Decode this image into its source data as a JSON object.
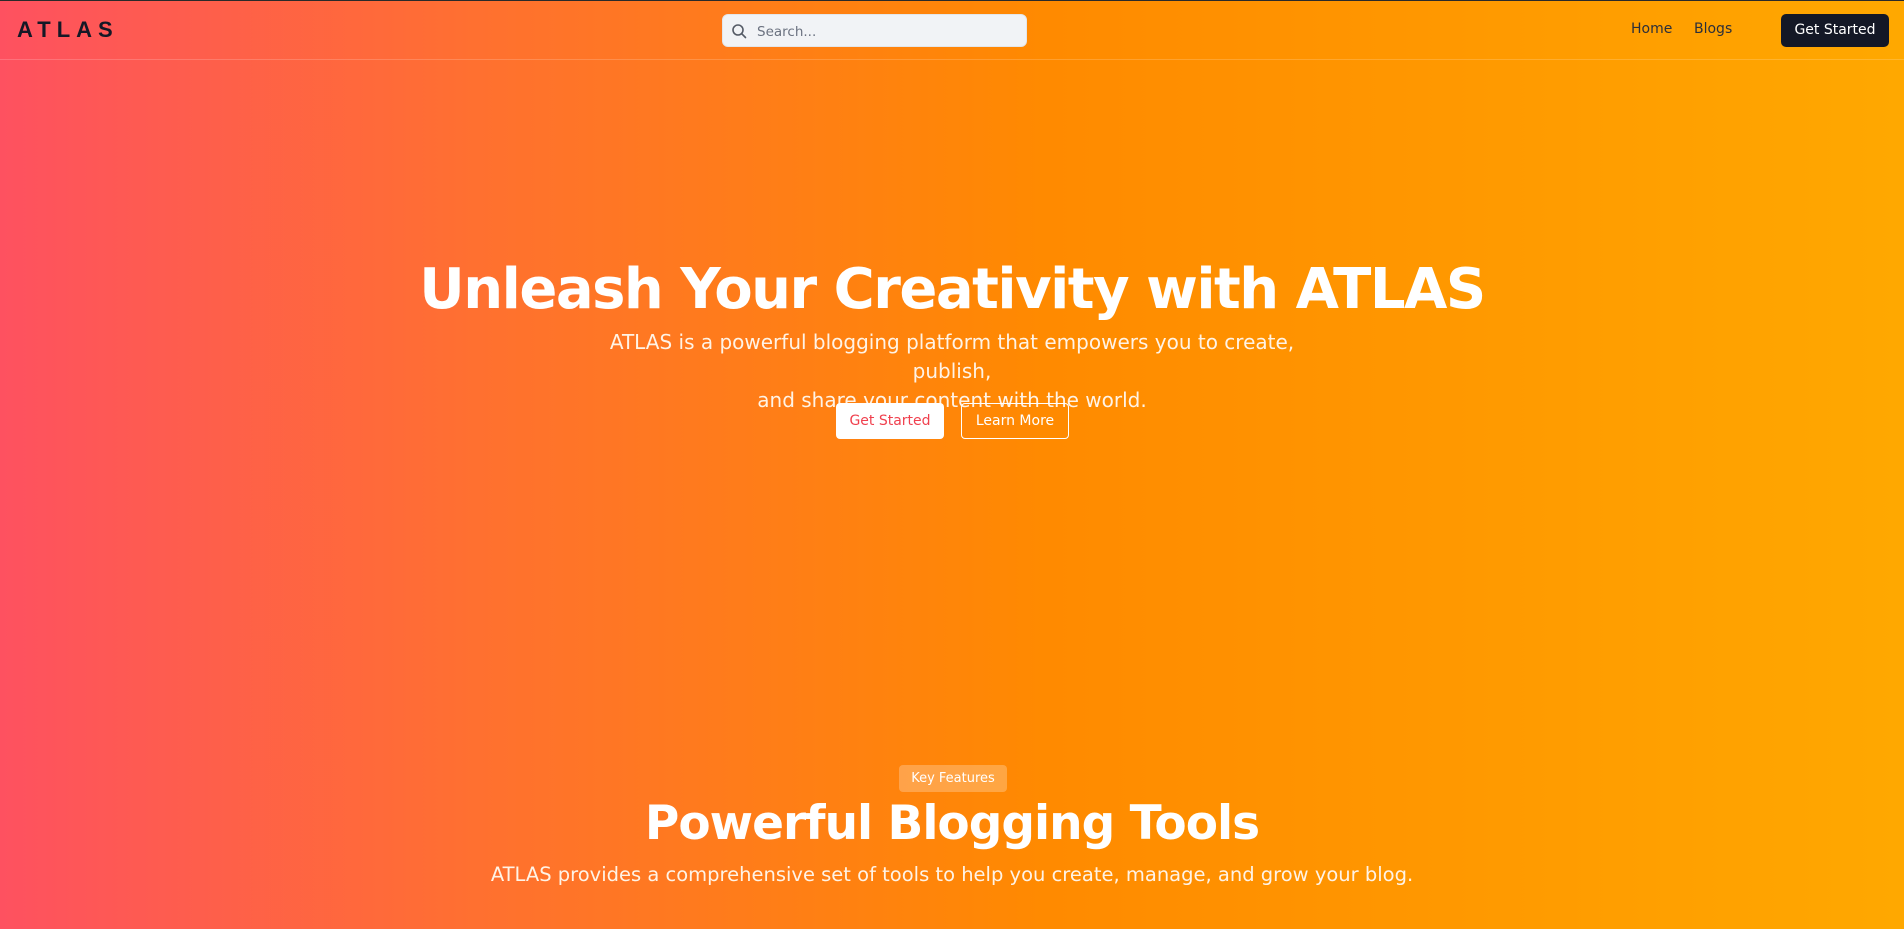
{
  "header": {
    "logo": "ATLAS",
    "search_placeholder": "Search...",
    "nav": [
      {
        "label": "Home"
      },
      {
        "label": "Blogs"
      }
    ],
    "cta_label": "Get Started",
    "search_icon": "search-icon"
  },
  "hero": {
    "title": "Unleash Your Creativity with ATLAS",
    "subtitle_line1": "ATLAS is a powerful blogging platform that empowers you to create, publish,",
    "subtitle_line2": "and share your content with the world.",
    "primary_button": "Get Started",
    "secondary_button": "Learn More"
  },
  "features": {
    "badge": "Key Features",
    "title": "Powerful Blogging Tools",
    "subtitle": "ATLAS provides a comprehensive set of tools to help you create, manage, and grow your blog."
  },
  "colors": {
    "gradient_start": "#fe5160",
    "gradient_end": "#ffa800",
    "dark": "#141826",
    "accent_text": "#f0404e"
  }
}
